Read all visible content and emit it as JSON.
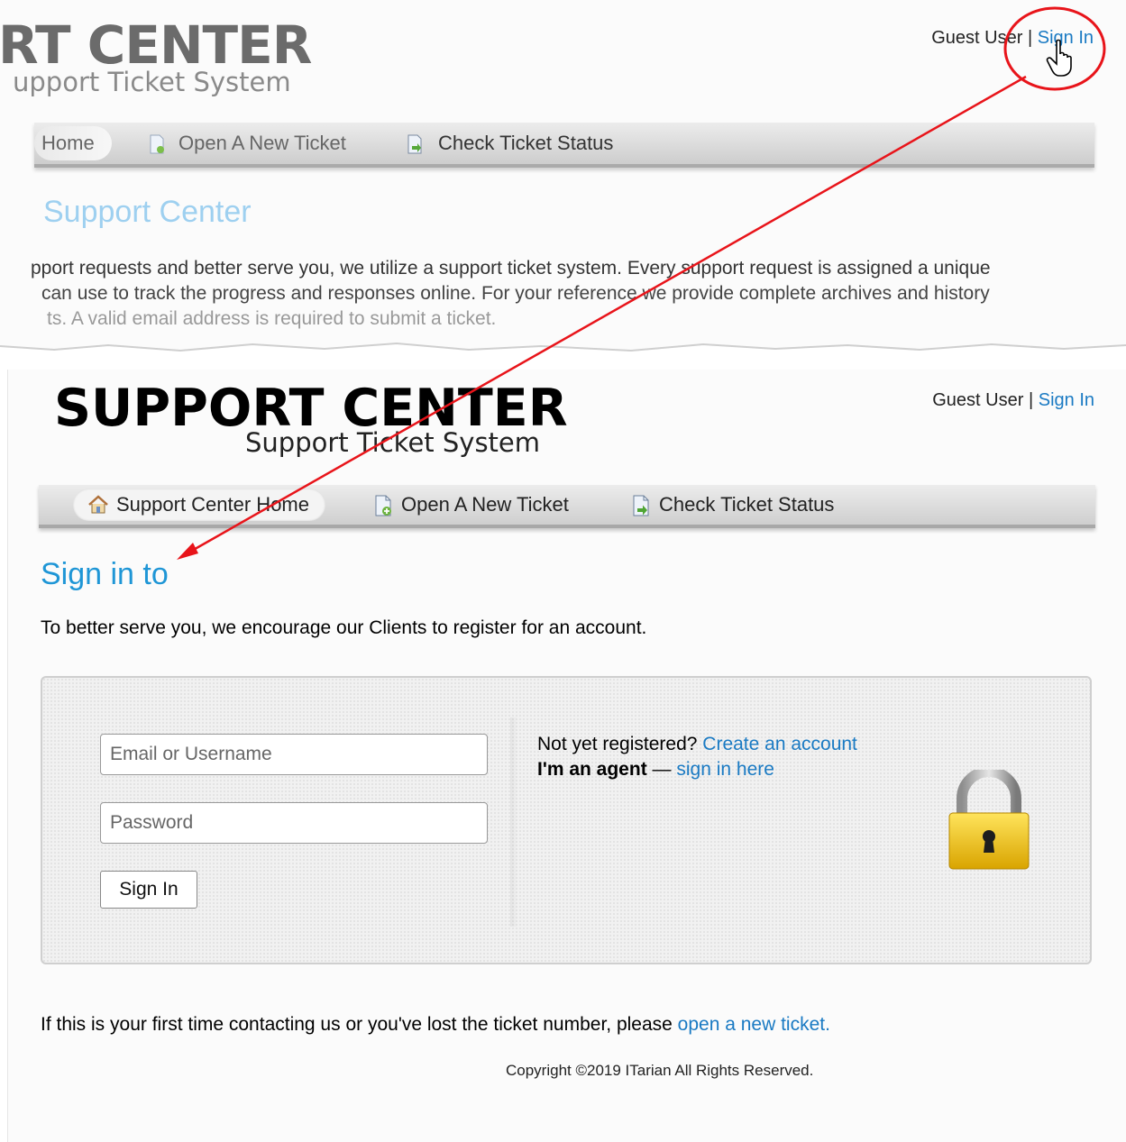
{
  "top_panel": {
    "logo_title": "RT CENTER",
    "logo_subtitle": "upport Ticket System",
    "user": {
      "guest_label": "Guest User",
      "separator": "|",
      "sign_in": "Sign In"
    },
    "nav": [
      {
        "label": "Home"
      },
      {
        "label": "Open A New Ticket"
      },
      {
        "label": "Check Ticket Status"
      }
    ],
    "heading": "Support Center",
    "paragraph": [
      "pport requests and better serve you, we utilize a support ticket system. Every support request is assigned a unique",
      "can use to track the progress and responses online. For your reference we provide complete archives and history",
      "ts. A valid email address is required to submit a ticket."
    ]
  },
  "main_panel": {
    "logo_title": "SUPPORT CENTER",
    "logo_subtitle": "Support Ticket System",
    "user": {
      "guest_label": "Guest User",
      "separator": "|",
      "sign_in": "Sign In"
    },
    "nav": [
      {
        "label": "Support Center Home",
        "icon": "home-icon",
        "active": true
      },
      {
        "label": "Open A New Ticket",
        "icon": "new-ticket-icon"
      },
      {
        "label": "Check Ticket Status",
        "icon": "ticket-status-icon"
      }
    ],
    "heading": "Sign in to",
    "intro": "To better serve you, we encourage our Clients to register for an account.",
    "login": {
      "email_placeholder": "Email or Username",
      "password_placeholder": "Password",
      "submit_label": "Sign In",
      "not_registered": "Not yet registered?",
      "create_account": "Create an account",
      "agent_label": "I'm an agent",
      "agent_dash": "—",
      "agent_link": "sign in here"
    },
    "footer": {
      "text": "If this is your first time contacting us or you've lost the ticket number, please",
      "link": "open a new ticket",
      "period": "."
    },
    "copyright": "Copyright ©2019 ITarian All Rights Reserved."
  },
  "colors": {
    "link": "#1a7ac3",
    "heading": "#1f96d6",
    "annotation": "#e8141a"
  }
}
